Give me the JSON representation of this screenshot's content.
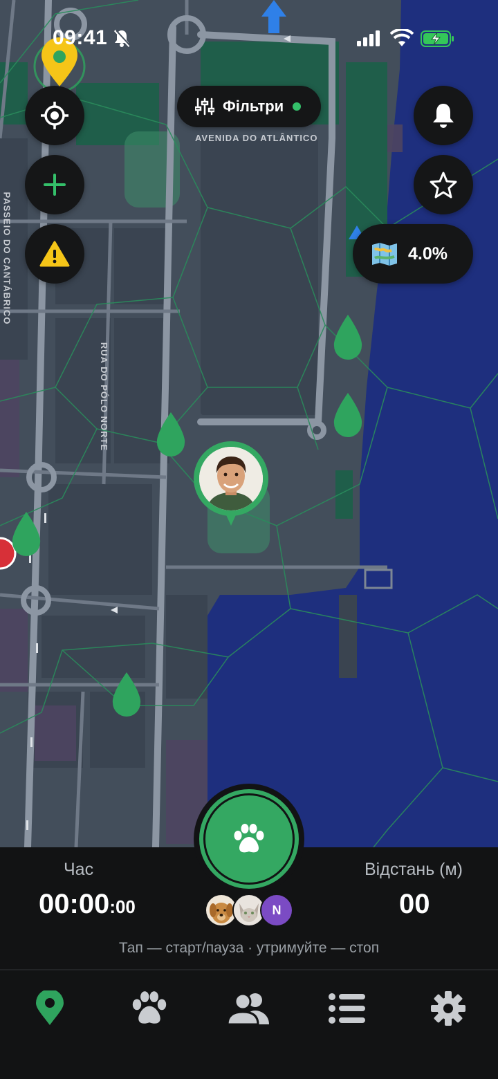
{
  "status_bar": {
    "time": "09:41"
  },
  "map": {
    "streets": [
      "AVENIDA DO ATLÂNTICO",
      "PASSEIO DO CANTÁBRICO",
      "RUA DO PÓLO NORTE"
    ]
  },
  "controls": {
    "filters_label": "Фільтри",
    "coverage_value": "4.0%"
  },
  "tracker": {
    "time_label": "Час",
    "time_main": "00:00",
    "time_fraction": ":00",
    "distance_label": "Відстань (м)",
    "distance_value": "00",
    "hint": "Тап — старт/пауза · утримуйте — стоп",
    "pets": [
      {
        "type": "dog"
      },
      {
        "type": "cat"
      },
      {
        "type": "initial",
        "letter": "N"
      }
    ]
  },
  "tabs": [
    {
      "name": "map",
      "icon": "location-pin-icon",
      "active": true
    },
    {
      "name": "pets",
      "icon": "paw-icon",
      "active": false
    },
    {
      "name": "friends",
      "icon": "users-icon",
      "active": false
    },
    {
      "name": "list",
      "icon": "list-icon",
      "active": false
    },
    {
      "name": "settings",
      "icon": "gear-icon",
      "active": false
    }
  ],
  "colors": {
    "accent": "#34a862",
    "water": "#1e2f7e",
    "land": "#424d5a",
    "panel": "#121314",
    "warning": "#f5c518"
  }
}
